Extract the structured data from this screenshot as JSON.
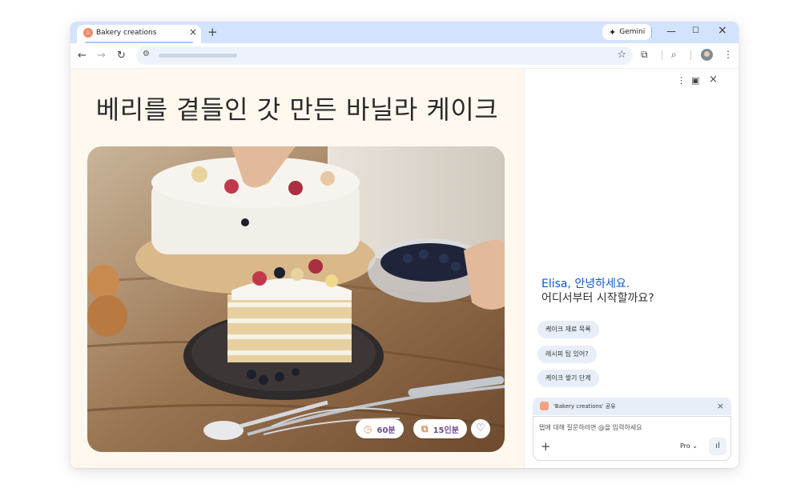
{
  "tab": {
    "title": "Bakery creations",
    "favicon": "bakery-favicon"
  },
  "titlebar": {
    "gemini_label": "Gemini"
  },
  "recipe": {
    "title": "베리를 곁들인 갓 만든 바닐라 케이크",
    "time_label": "60분",
    "servings_label": "15인분"
  },
  "panel": {
    "greeting_name": "Elisa, 안녕하세요.",
    "greeting_sub": "어디서부터 시작할까요?",
    "chips": [
      "케이크 재료 목록",
      "레시피 팁 있어?",
      "케이크 쌓기 단계"
    ],
    "share_label": "'Bakery creations' 공유",
    "input_placeholder": "탭에 대해 질문하려면 @을 입력하세요",
    "model_label": "Pro"
  },
  "colors": {
    "accent_blue": "#0b57d0",
    "tab_strip": "#d3e3fd",
    "page_bg": "#fff8ef",
    "pill_text": "#6b4a8a"
  }
}
